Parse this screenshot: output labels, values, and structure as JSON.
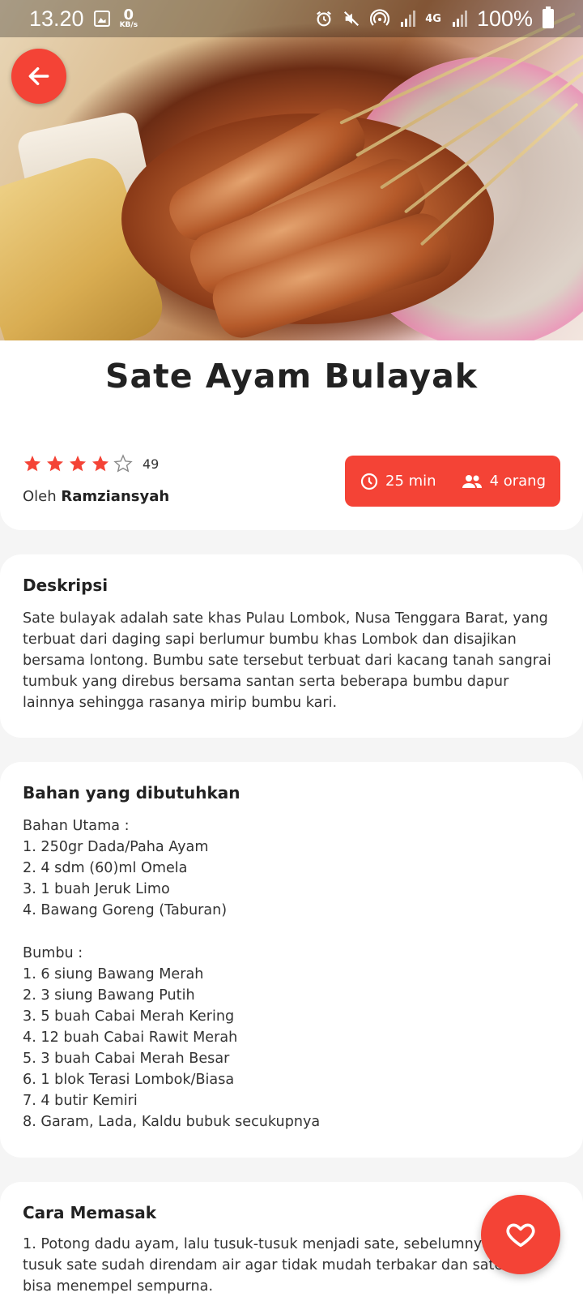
{
  "status_bar": {
    "time": "13.20",
    "net_speed_value": "0",
    "net_speed_unit": "KB/s",
    "network": "4G",
    "battery": "100%",
    "icons": [
      "gallery-icon",
      "alarm-icon",
      "mute-icon",
      "hotspot-icon",
      "signal-icon",
      "battery-icon"
    ]
  },
  "recipe": {
    "title": "Sate Ayam Bulayak",
    "rating": 4,
    "rating_max": 5,
    "rating_count": "49",
    "author_prefix": "Oleh",
    "author": "Ramziansyah",
    "time": "25 min",
    "servings": "4 orang"
  },
  "description": {
    "heading": "Deskripsi",
    "text": "Sate bulayak adalah sate khas Pulau Lombok, Nusa Tenggara Barat, yang terbuat dari daging sapi berlumur bumbu khas Lombok dan disajikan bersama lontong. Bumbu sate tersebut terbuat dari kacang tanah sangrai tumbuk yang direbus bersama santan serta beberapa bumbu dapur lainnya sehingga rasanya mirip bumbu kari."
  },
  "ingredients": {
    "heading": "Bahan yang dibutuhkan",
    "lines": [
      "Bahan Utama :",
      "1. 250gr Dada/Paha Ayam",
      "2. 4 sdm (60)ml Omela",
      "3. 1 buah Jeruk Limo",
      "4. Bawang Goreng (Taburan)",
      "",
      "Bumbu :",
      "1. 6 siung Bawang Merah",
      "2. 3 siung Bawang Putih",
      "3. 5 buah Cabai Merah Kering",
      "4. 12 buah Cabai Rawit Merah",
      "5. 3 buah Cabai Merah Besar",
      "6. 1 blok Terasi Lombok/Biasa",
      "7. 4 butir Kemiri",
      "8. Garam, Lada, Kaldu bubuk secukupnya"
    ]
  },
  "cooking": {
    "heading": "Cara Memasak",
    "text": "1. Potong dadu ayam, lalu tusuk-tusuk menjadi sate, sebelumnya tusuk sate sudah direndam air agar tidak mudah terbakar dan sate bisa menempel sempurna."
  },
  "colors": {
    "accent": "#f44336"
  }
}
